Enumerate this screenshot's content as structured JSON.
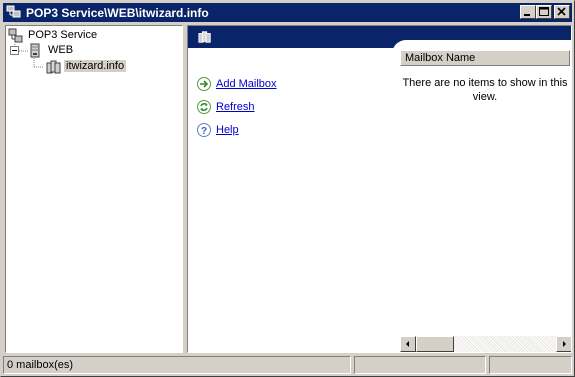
{
  "window": {
    "title": "POP3 Service\\WEB\\itwizard.info",
    "icons": {
      "app": "server-tree-icon",
      "minimize": "minimize-icon",
      "maximize": "maximize-icon",
      "close": "close-icon"
    }
  },
  "tree": {
    "items": [
      {
        "label": "POP3 Service",
        "icon": "pop3-service-icon"
      },
      {
        "label": "WEB",
        "icon": "server-icon",
        "expander": "−"
      },
      {
        "label": "itwizard.info",
        "icon": "domain-icon",
        "selected": true
      }
    ]
  },
  "tasks": [
    {
      "label": "Add Mailbox",
      "icon": "add-arrow-icon"
    },
    {
      "label": "Refresh",
      "icon": "refresh-icon"
    },
    {
      "label": "Help",
      "icon": "help-icon"
    }
  ],
  "list": {
    "columns": [
      "Mailbox Name"
    ],
    "empty_message": "There are no items to show in this view."
  },
  "status": {
    "text": "0 mailbox(es)"
  },
  "colors": {
    "titlebar": "#0a246a",
    "link": "#0000cc",
    "face": "#d4d0c8"
  }
}
